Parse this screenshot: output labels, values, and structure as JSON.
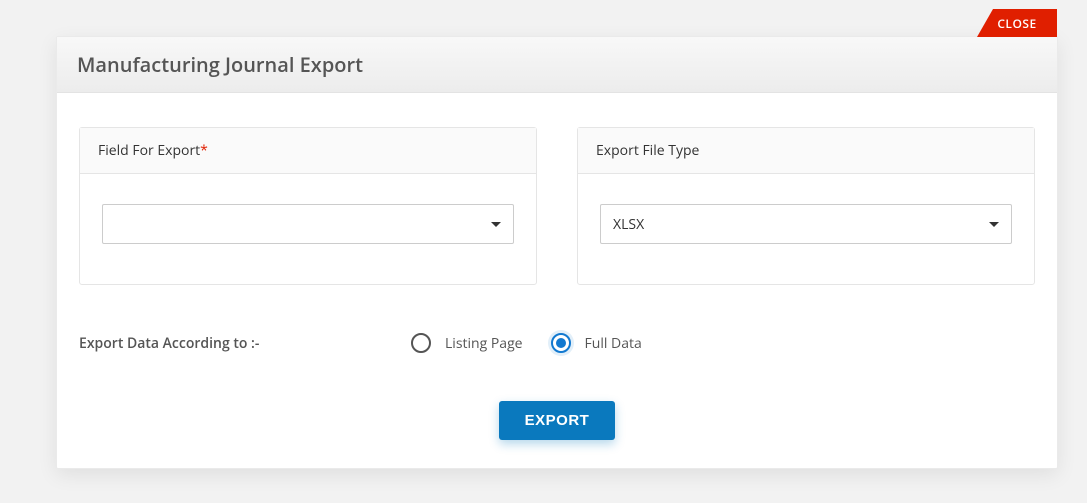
{
  "close_label": "CLOSE",
  "modal_title": "Manufacturing Journal Export",
  "field_card": {
    "label": "Field For Export",
    "required_mark": "*",
    "value": ""
  },
  "filetype_card": {
    "label": "Export File Type",
    "value": "XLSX"
  },
  "radio_section": {
    "lead": "Export Data According to :-",
    "option_listing": "Listing Page",
    "option_full": "Full Data"
  },
  "export_button": "EXPORT"
}
